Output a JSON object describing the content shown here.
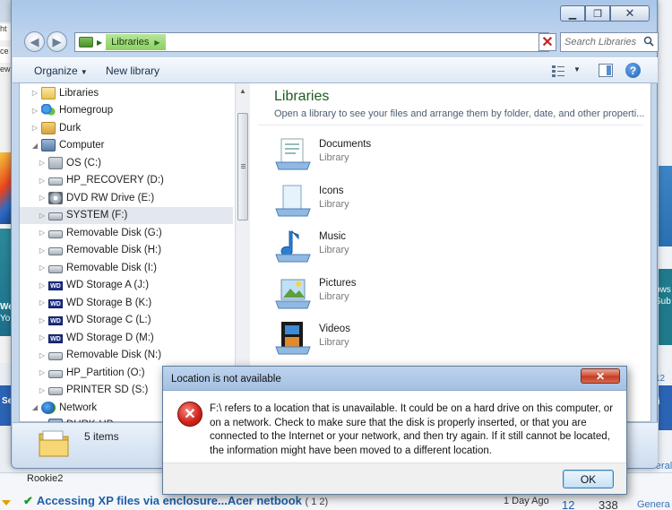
{
  "background": {
    "left_tab_text": "ht",
    "left_tab_text2": "ce",
    "left_text3": "ew",
    "right_texts": [
      "ows",
      "Sub",
      "ri",
      "12",
      "1"
    ],
    "left_texts": [
      "We",
      "You",
      "Se"
    ],
    "username": "Rookie2",
    "thread_title": "Accessing XP files via enclosure...Acer netbook",
    "thread_pages": "( 1 2)",
    "last_post": "1 Day Ago",
    "replies": "12",
    "views": "338",
    "forum_label": "General",
    "forum_label2": "Genera"
  },
  "explorer": {
    "address": {
      "crumb": "Libraries"
    },
    "search_placeholder": "Search Libraries",
    "toolbar": {
      "organize": "Organize",
      "new_library": "New library"
    },
    "tree": [
      {
        "label": "Libraries",
        "icon": "folder-icon",
        "indent": 1
      },
      {
        "label": "Homegroup",
        "icon": "homegroup-icon",
        "indent": 1
      },
      {
        "label": "Durk",
        "icon": "user-folder-icon",
        "indent": 1
      },
      {
        "label": "Computer",
        "icon": "computer-icon",
        "indent": 1,
        "expanded": true
      },
      {
        "label": "OS (C:)",
        "icon": "os-drive-icon",
        "indent": 2
      },
      {
        "label": "HP_RECOVERY (D:)",
        "icon": "drive-icon",
        "indent": 2
      },
      {
        "label": "DVD RW Drive (E:)",
        "icon": "dvd-drive-icon",
        "indent": 2
      },
      {
        "label": "SYSTEM (F:)",
        "icon": "drive-icon",
        "indent": 2,
        "selected": true
      },
      {
        "label": "Removable Disk (G:)",
        "icon": "removable-disk-icon",
        "indent": 2
      },
      {
        "label": "Removable Disk (H:)",
        "icon": "removable-disk-icon",
        "indent": 2
      },
      {
        "label": "Removable Disk (I:)",
        "icon": "removable-disk-icon",
        "indent": 2
      },
      {
        "label": "WD Storage A (J:)",
        "icon": "wd-drive-icon",
        "indent": 2
      },
      {
        "label": "WD Storage B (K:)",
        "icon": "wd-drive-icon",
        "indent": 2
      },
      {
        "label": "WD Storage C (L:)",
        "icon": "wd-drive-icon",
        "indent": 2
      },
      {
        "label": "WD Storage D (M:)",
        "icon": "wd-drive-icon",
        "indent": 2
      },
      {
        "label": "Removable Disk (N:)",
        "icon": "removable-disk-icon",
        "indent": 2
      },
      {
        "label": "HP_Partition (O:)",
        "icon": "drive-icon",
        "indent": 2
      },
      {
        "label": "PRINTER SD (S:)",
        "icon": "removable-disk-icon",
        "indent": 2
      },
      {
        "label": "Network",
        "icon": "network-icon",
        "indent": 1,
        "expanded": true
      },
      {
        "label": "DURK-HP",
        "icon": "computer-icon",
        "indent": 2
      }
    ],
    "main": {
      "title": "Libraries",
      "subtitle": "Open a library to see your files and arrange them by folder, date, and other properti...",
      "libraries": [
        {
          "name": "Documents",
          "type": "Library",
          "icon": "documents-library-icon"
        },
        {
          "name": "Icons",
          "type": "Library",
          "icon": "icons-library-icon"
        },
        {
          "name": "Music",
          "type": "Library",
          "icon": "music-library-icon"
        },
        {
          "name": "Pictures",
          "type": "Library",
          "icon": "pictures-library-icon"
        },
        {
          "name": "Videos",
          "type": "Library",
          "icon": "videos-library-icon"
        }
      ]
    },
    "status": {
      "item_count": "5 items"
    }
  },
  "dialog": {
    "title": "Location is not available",
    "message": "F:\\ refers to a location that is unavailable. It could be on a hard drive on this computer, or on a network. Check to make sure that the disk is properly inserted, or that you are connected to the Internet or your network, and then try again. If it still cannot be located, the information might have been moved to a different location.",
    "ok_label": "OK",
    "icon": "error-icon"
  }
}
